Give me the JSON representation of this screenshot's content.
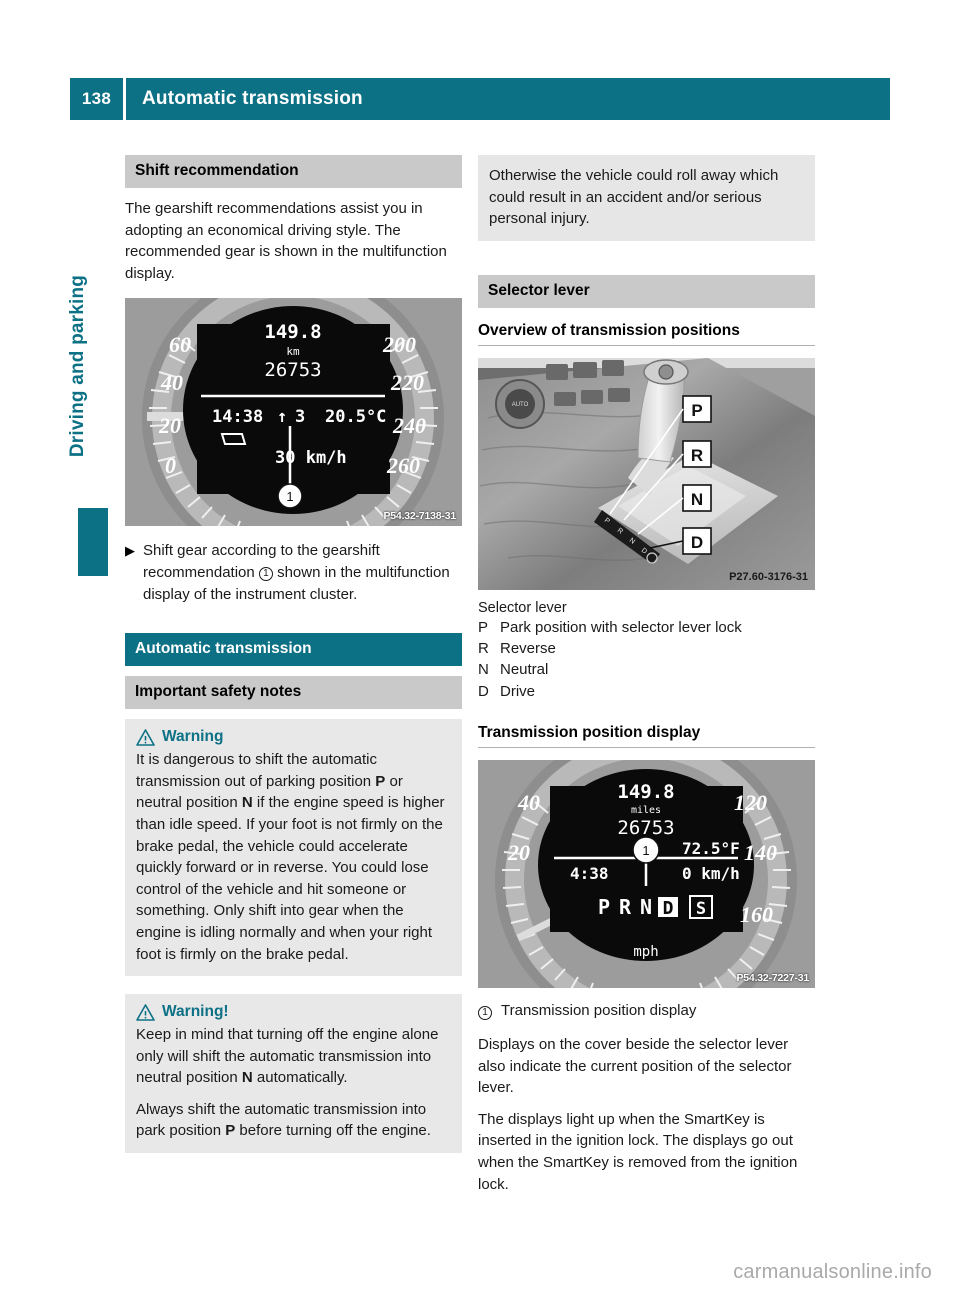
{
  "header": {
    "page_number": "138",
    "title": "Automatic transmission"
  },
  "side_tab": {
    "label": "Driving and parking"
  },
  "accent_colors": {
    "teal": "#0d7186",
    "bar_gray": "#c9c9c9",
    "box_gray": "#e8e8e8"
  },
  "left_column": {
    "section_shift": {
      "bar_label": "Shift recommendation",
      "paragraph": "The gearshift recommendations assist you in adopting an economical driving style. The recommended gear is shown in the multifunction display."
    },
    "figure_cluster_kmh": {
      "code": "P54.32-7138-31",
      "trip": "149.8",
      "trip_unit": "km",
      "odometer": "26753",
      "time": "14:38",
      "gear_arrow": "↑",
      "gear": "3",
      "temperature": "20.5°C",
      "speed": "30 km/h",
      "dial_ticks": [
        "0",
        "20",
        "40",
        "60",
        "200",
        "220",
        "240",
        "260"
      ],
      "callout": "1"
    },
    "step": {
      "marker": "▶",
      "text_before": "Shift gear according to the gearshift recommendation",
      "callout": "1",
      "text_after": "shown in the multifunction display of the instrument cluster."
    },
    "section_auto": {
      "bar_label": "Automatic transmission",
      "sub_bar_label": "Important safety notes"
    },
    "warning_1": {
      "title": "Warning",
      "icon": "warning-triangle-icon",
      "parts": [
        {
          "t": "It is dangerous to shift the automatic transmission out of parking position ",
          "b": false
        },
        {
          "t": "P",
          "b": true
        },
        {
          "t": " or neutral position ",
          "b": false
        },
        {
          "t": "N",
          "b": true
        },
        {
          "t": " if the engine speed is higher than idle speed. If your foot is not firmly on the brake pedal, the vehicle could accelerate quickly forward or in reverse. You could lose control of the vehicle and hit someone or something. Only shift into gear when the engine is idling normally and when your right foot is firmly on the brake pedal.",
          "b": false
        }
      ]
    },
    "warning_2": {
      "title": "Warning!",
      "icon": "warning-triangle-icon",
      "para1_parts": [
        {
          "t": "Keep in mind that turning off the engine alone only will shift the automatic transmission into neutral position ",
          "b": false
        },
        {
          "t": "N",
          "b": true
        },
        {
          "t": " automatically.",
          "b": false
        }
      ],
      "para2_parts": [
        {
          "t": "Always shift the automatic transmission into park position ",
          "b": false
        },
        {
          "t": "P",
          "b": true
        },
        {
          "t": " before turning off the engine.",
          "b": false
        }
      ]
    }
  },
  "right_column": {
    "note_continued": "Otherwise the vehicle could roll away which could result in an accident and/or serious personal injury.",
    "section_selector": {
      "bar_label": "Selector lever",
      "heading_overview": "Overview of transmission positions"
    },
    "figure_lever": {
      "code": "P27.60-3176-31",
      "callout_labels": [
        "P",
        "R",
        "N",
        "D"
      ]
    },
    "legend": {
      "caption": "Selector lever",
      "rows": [
        {
          "key": "P",
          "text": "Park position with selector lever lock"
        },
        {
          "key": "R",
          "text": "Reverse"
        },
        {
          "key": "N",
          "text": "Neutral"
        },
        {
          "key": "D",
          "text": "Drive"
        }
      ]
    },
    "heading_position_display": "Transmission position display",
    "figure_cluster_mph": {
      "code": "P54.32-7227-31",
      "trip": "149.8",
      "trip_unit": "miles",
      "odometer": "26753",
      "time": "4:38",
      "temperature": "72.5°F",
      "speed": "0 km/h",
      "unit_label": "mph",
      "gear_letters": [
        "P",
        "R",
        "N",
        "D"
      ],
      "active_gear": "D",
      "sport_badge": "S",
      "dial_ticks": [
        "20",
        "40",
        "120",
        "140",
        "160"
      ],
      "callout": "1"
    },
    "callout_line": {
      "callout": "1",
      "text": "Transmission position display"
    },
    "para1": "Displays on the cover beside the selector lever also indicate the current position of the selector lever.",
    "para2": "The displays light up when the SmartKey is inserted in the ignition lock. The displays go out when the SmartKey is removed from the ignition lock."
  },
  "footer": {
    "watermark": "carmanualsonline.info"
  }
}
